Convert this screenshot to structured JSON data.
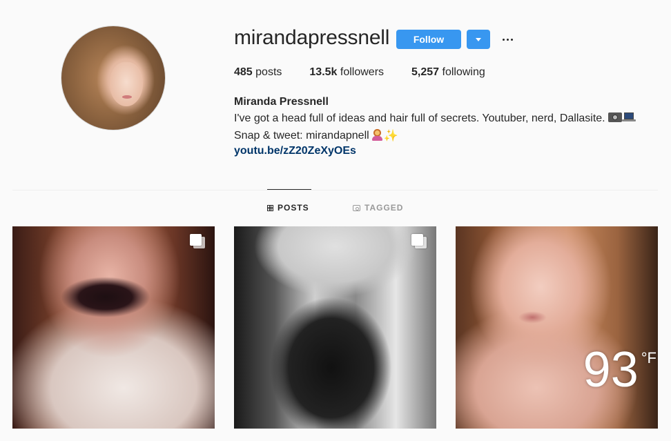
{
  "profile": {
    "username": "mirandapressnell",
    "follow_label": "Follow",
    "stats": {
      "posts_value": "485",
      "posts_label": " posts",
      "followers_value": "13.5k",
      "followers_label": " followers",
      "following_value": "5,257",
      "following_label": " following"
    },
    "full_name": "Miranda Pressnell",
    "bio_line1": "I've got a head full of ideas and hair full of secrets. Youtuber, nerd, Dallasite.",
    "bio_line2": "Snap & tweet: mirandapnell",
    "link": "youtu.be/zZ20ZeXyOEs"
  },
  "tabs": [
    {
      "label": "POSTS",
      "icon": "grid-icon",
      "active": true
    },
    {
      "label": "TAGGED",
      "icon": "tag-icon",
      "active": false
    }
  ],
  "posts": [
    {
      "multiple": true
    },
    {
      "multiple": true
    },
    {
      "multiple": false,
      "overlay_temp": "93",
      "overlay_unit": "°F"
    }
  ],
  "colors": {
    "accent": "#3897f0",
    "link": "#003569",
    "background": "#fafafa",
    "text": "#262626"
  }
}
